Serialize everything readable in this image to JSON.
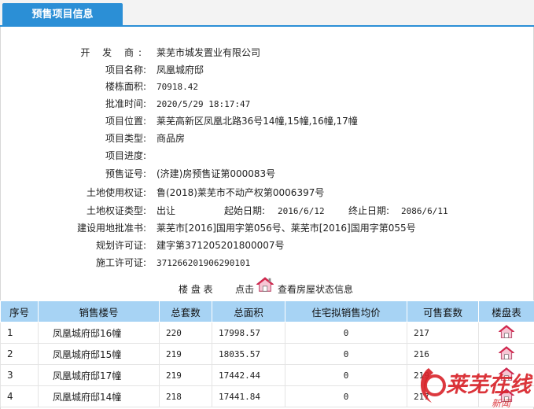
{
  "tab": {
    "title": "预售项目信息"
  },
  "info": {
    "developer_label": "开 发 商:",
    "developer": "莱芜市城发置业有限公司",
    "project_name_label": "项目名称:",
    "project_name": "凤凰城府邸",
    "building_area_label": "楼栋面积:",
    "building_area": "70918.42",
    "approval_time_label": "批准时间:",
    "approval_time": "2020/5/29 18:17:47",
    "location_label": "项目位置:",
    "location": "莱芜高新区凤凰北路36号14幢,15幢,16幢,17幢",
    "type_label": "项目类型:",
    "type": "商品房",
    "progress_label": "项目进度:",
    "progress": "",
    "presale_cert_label": "预售证号:",
    "presale_cert": "(济建)房预售证第000083号",
    "land_use_label": "土地使用权证:",
    "land_use": "鲁(2018)莱芜市不动产权第0006397号",
    "land_right_type_label": "土地权证类型:",
    "land_right_type": "出让",
    "start_date_label": "起始日期:",
    "start_date": "2016/6/12",
    "end_date_label": "终止日期:",
    "end_date": "2086/6/11",
    "land_plan_label": "建设用地批准书:",
    "land_plan": "莱芜市[2016]国用字第056号、莱芜市[2016]国用字第055号",
    "planning_permit_label": "规划许可证:",
    "planning_permit": "建字第371205201800007号",
    "construction_permit_label": "施工许可证:",
    "construction_permit": "371266201906290101"
  },
  "table_caption": {
    "title": "楼 盘 表",
    "click": "点击",
    "view": "查看房屋状态信息",
    "icon": "house-icon"
  },
  "table": {
    "headers": [
      "序号",
      "销售楼号",
      "总套数",
      "总面积",
      "住宅拟销售均价",
      "可售套数",
      "楼盘表"
    ],
    "rows": [
      {
        "no": "1",
        "name": "凤凰城府邸16幢",
        "units": "220",
        "area": "17998.57",
        "avg_price": "0",
        "available": "217"
      },
      {
        "no": "2",
        "name": "凤凰城府邸15幢",
        "units": "219",
        "area": "18035.57",
        "avg_price": "0",
        "available": "216"
      },
      {
        "no": "3",
        "name": "凤凰城府邸17幢",
        "units": "219",
        "area": "17442.44",
        "avg_price": "0",
        "available": "219"
      },
      {
        "no": "4",
        "name": "凤凰城府邸14幢",
        "units": "218",
        "area": "17441.84",
        "avg_price": "0",
        "available": "217"
      }
    ]
  },
  "watermark": {
    "brand": "莱芜在线",
    "sub": "新闻"
  },
  "colors": {
    "tab_blue": "#2b8fd6",
    "header_blue": "#a7d3f4",
    "watermark_red": "#d8232a"
  }
}
